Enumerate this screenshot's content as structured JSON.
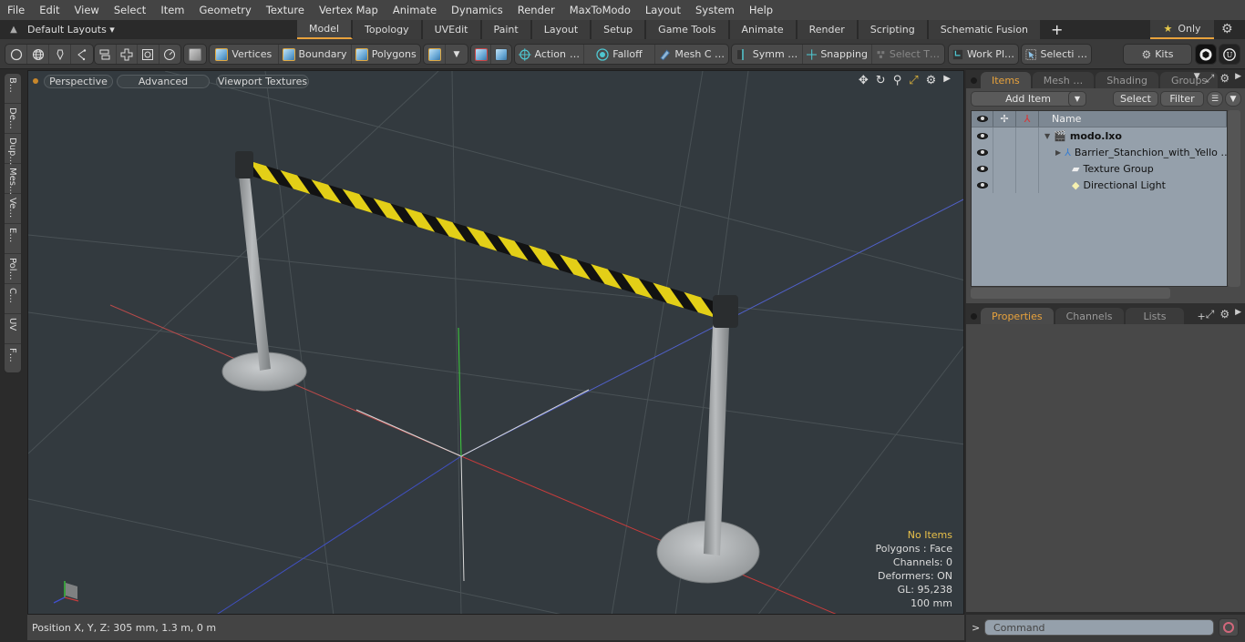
{
  "menu": [
    "File",
    "Edit",
    "View",
    "Select",
    "Item",
    "Geometry",
    "Texture",
    "Vertex Map",
    "Animate",
    "Dynamics",
    "Render",
    "MaxToModo",
    "Layout",
    "System",
    "Help"
  ],
  "layoutbar": {
    "layouts_label": "Default Layouts ▾",
    "tabs": [
      "Model",
      "Topology",
      "UVEdit",
      "Paint",
      "Layout",
      "Setup",
      "Game Tools",
      "Animate",
      "Render",
      "Scripting",
      "Schematic Fusion"
    ],
    "active_tab": "Model",
    "add_tab": "+",
    "only_label": "Only",
    "star": "★",
    "gear": "⚙"
  },
  "toolbar": {
    "vertices": "Vertices",
    "boundary": "Boundary",
    "polygons": "Polygons",
    "action": "Action",
    "action_more": "…",
    "falloff": "Falloff",
    "mesh_c": "Mesh C …",
    "symm": "Symm …",
    "snapping": "Snapping",
    "select_t": "Select T…",
    "work_pl": "Work Pl…",
    "selecti": "Selecti …",
    "kits": "Kits"
  },
  "left_tabs": [
    "B…",
    "De…",
    "Dup…",
    "Mes…",
    "Ve…",
    "E…",
    "Pol…",
    "C…",
    "UV",
    "F…"
  ],
  "viewport": {
    "view_mode": "Perspective",
    "shading": "Advanced",
    "textures": "Viewport Textures",
    "stats": {
      "selection": "No Items",
      "polygons": "Polygons : Face",
      "channels": "Channels: 0",
      "deformers": "Deformers: ON",
      "gl": "GL: 95,238",
      "grid": "100 mm"
    },
    "colors": {
      "background": "#333a3f",
      "tape_yellow": "#e6d21a",
      "tape_black": "#111111",
      "post": "#a9adaf",
      "x_axis": "#c84040",
      "y_axis": "#3fc43f",
      "z_axis": "#4050c8"
    }
  },
  "items_panel": {
    "tabs": [
      "Items",
      "Mesh …",
      "Shading",
      "Groups"
    ],
    "active_tab": "Items",
    "add_item": "Add Item",
    "select": "Select",
    "filter": "Filter",
    "column_name": "Name",
    "tree": [
      {
        "label": "modo.lxo",
        "bold": true
      },
      {
        "label": "Barrier_Stanchion_with_Yello …"
      },
      {
        "label": "Texture Group"
      },
      {
        "label": "Directional Light"
      }
    ]
  },
  "props_panel": {
    "tabs": [
      "Properties",
      "Channels",
      "Lists"
    ],
    "active_tab": "Properties",
    "add": "+"
  },
  "status": {
    "position": "Position X, Y, Z:   305 mm, 1.3 m, 0 m"
  },
  "command": {
    "prompt": ">",
    "placeholder": "Command"
  }
}
